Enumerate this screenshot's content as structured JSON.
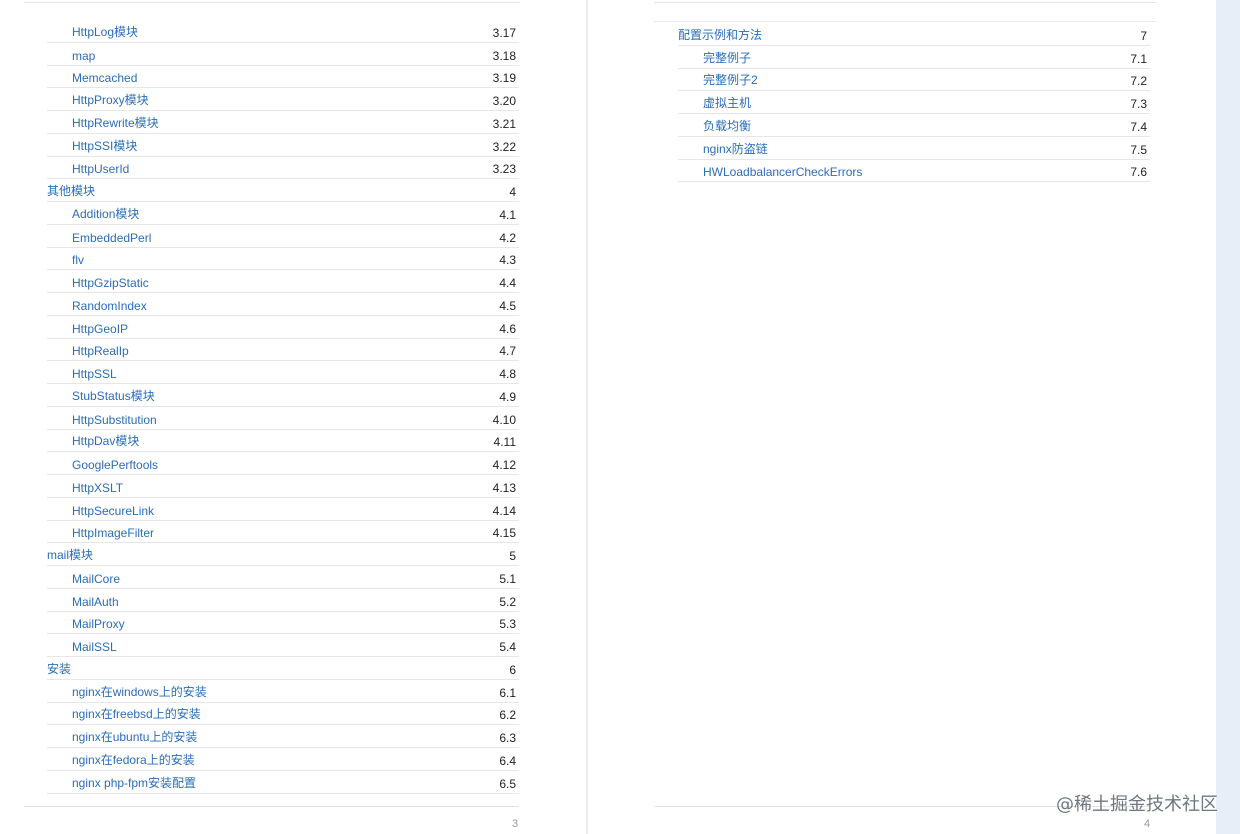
{
  "left_page": {
    "page_number": "3",
    "entries": [
      {
        "level": 2,
        "label": "HttpLog模块",
        "num": "3.17"
      },
      {
        "level": 2,
        "label": "map",
        "num": "3.18"
      },
      {
        "level": 2,
        "label": "Memcached",
        "num": "3.19"
      },
      {
        "level": 2,
        "label": "HttpProxy模块",
        "num": "3.20"
      },
      {
        "level": 2,
        "label": "HttpRewrite模块",
        "num": "3.21"
      },
      {
        "level": 2,
        "label": "HttpSSI模块",
        "num": "3.22"
      },
      {
        "level": 2,
        "label": "HttpUserId",
        "num": "3.23"
      },
      {
        "level": 1,
        "label": "其他模块",
        "num": "4"
      },
      {
        "level": 2,
        "label": "Addition模块",
        "num": "4.1"
      },
      {
        "level": 2,
        "label": "EmbeddedPerl",
        "num": "4.2"
      },
      {
        "level": 2,
        "label": "flv",
        "num": "4.3"
      },
      {
        "level": 2,
        "label": "HttpGzipStatic",
        "num": "4.4"
      },
      {
        "level": 2,
        "label": "RandomIndex",
        "num": "4.5"
      },
      {
        "level": 2,
        "label": "HttpGeoIP",
        "num": "4.6"
      },
      {
        "level": 2,
        "label": "HttpRealIp",
        "num": "4.7"
      },
      {
        "level": 2,
        "label": "HttpSSL",
        "num": "4.8"
      },
      {
        "level": 2,
        "label": "StubStatus模块",
        "num": "4.9"
      },
      {
        "level": 2,
        "label": "HttpSubstitution",
        "num": "4.10"
      },
      {
        "level": 2,
        "label": "HttpDav模块",
        "num": "4.11"
      },
      {
        "level": 2,
        "label": "GooglePerftools",
        "num": "4.12"
      },
      {
        "level": 2,
        "label": "HttpXSLT",
        "num": "4.13"
      },
      {
        "level": 2,
        "label": "HttpSecureLink",
        "num": "4.14"
      },
      {
        "level": 2,
        "label": "HttpImageFilter",
        "num": "4.15"
      },
      {
        "level": 1,
        "label": "mail模块",
        "num": "5"
      },
      {
        "level": 2,
        "label": "MailCore",
        "num": "5.1"
      },
      {
        "level": 2,
        "label": "MailAuth",
        "num": "5.2"
      },
      {
        "level": 2,
        "label": "MailProxy",
        "num": "5.3"
      },
      {
        "level": 2,
        "label": "MailSSL",
        "num": "5.4"
      },
      {
        "level": 1,
        "label": "安装",
        "num": "6"
      },
      {
        "level": 2,
        "label": "nginx在windows上的安装",
        "num": "6.1"
      },
      {
        "level": 2,
        "label": "nginx在freebsd上的安装",
        "num": "6.2"
      },
      {
        "level": 2,
        "label": "nginx在ubuntu上的安装",
        "num": "6.3"
      },
      {
        "level": 2,
        "label": "nginx在fedora上的安装",
        "num": "6.4"
      },
      {
        "level": 2,
        "label": "nginx php-fpm安装配置",
        "num": "6.5"
      }
    ]
  },
  "right_page": {
    "page_number": "4",
    "entries": [
      {
        "level": 1,
        "label": "配置示例和方法",
        "num": "7"
      },
      {
        "level": 2,
        "label": "完整例子",
        "num": "7.1"
      },
      {
        "level": 2,
        "label": "完整例子2",
        "num": "7.2"
      },
      {
        "level": 2,
        "label": "虚拟主机",
        "num": "7.3"
      },
      {
        "level": 2,
        "label": "负载均衡",
        "num": "7.4"
      },
      {
        "level": 2,
        "label": "nginx防盗链",
        "num": "7.5"
      },
      {
        "level": 2,
        "label": "HWLoadbalancerCheckErrors",
        "num": "7.6"
      }
    ]
  },
  "watermark": "@稀土掘金技术社区",
  "colors": {
    "link": "#2a6db8",
    "number": "#222222",
    "rule": "#e6e6e6"
  }
}
